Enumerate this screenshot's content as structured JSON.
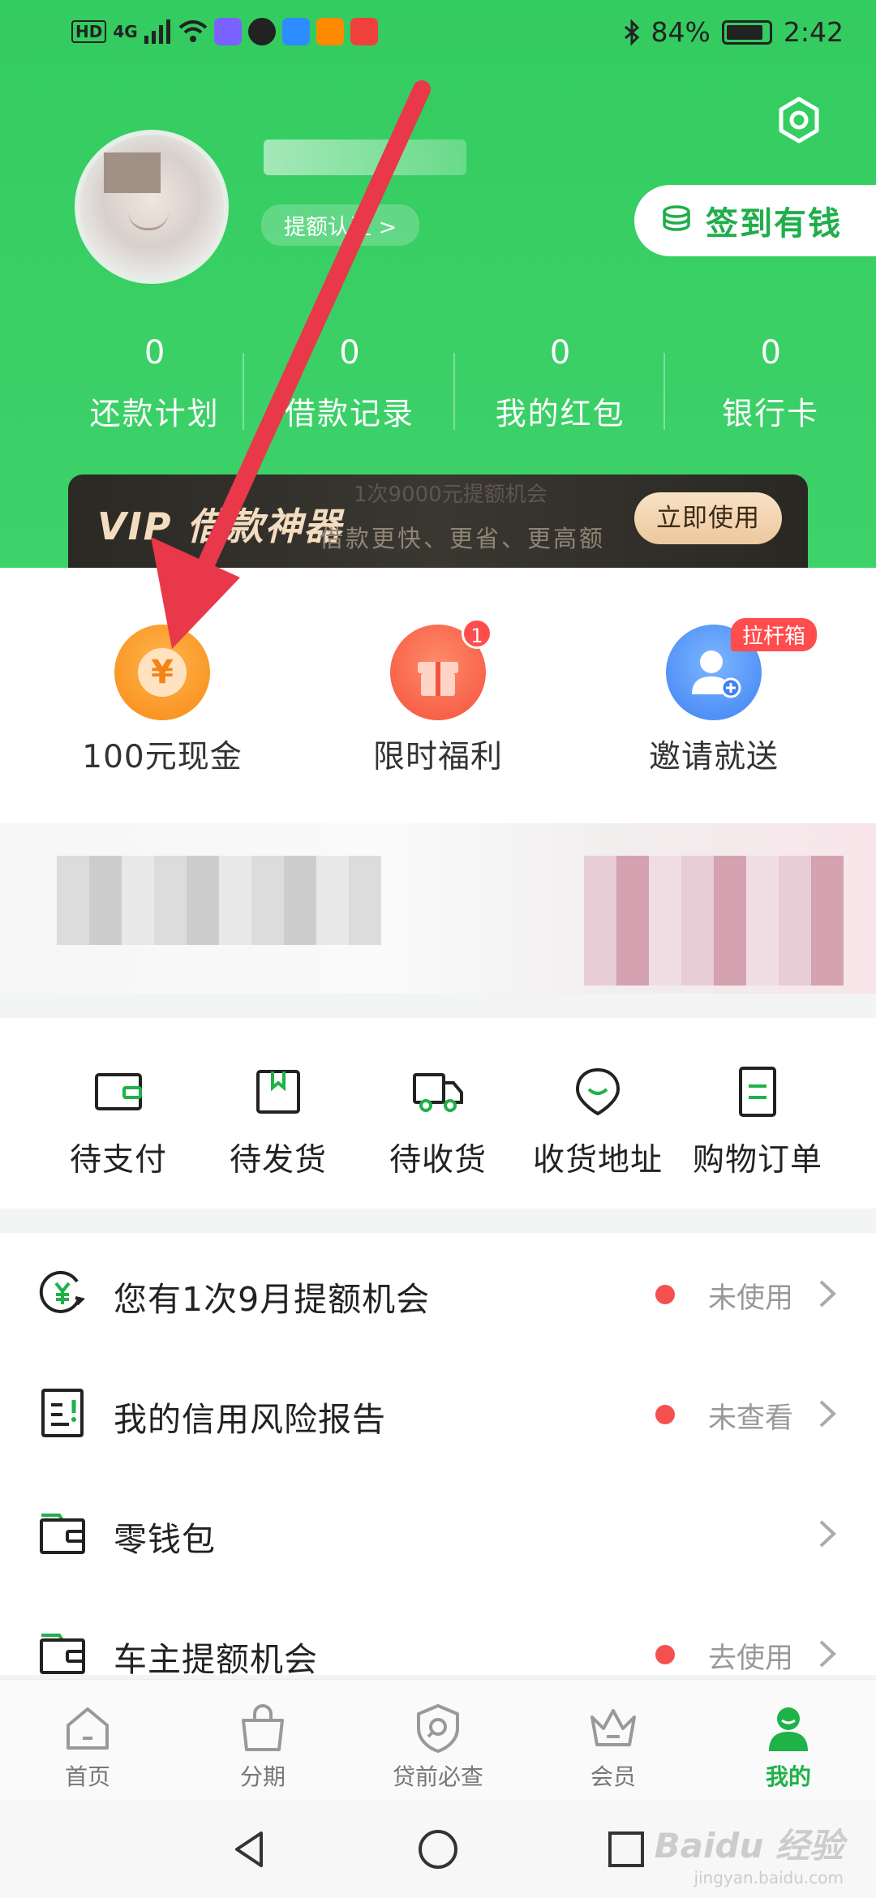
{
  "status_bar": {
    "network": "4G",
    "battery": "84%",
    "time": "2:42"
  },
  "header": {
    "verify_link": "提额认证 >",
    "signin_button": "签到有钱",
    "stats": [
      {
        "value": "0",
        "label": "还款计划"
      },
      {
        "value": "0",
        "label": "借款记录"
      },
      {
        "value": "0",
        "label": "我的红包"
      },
      {
        "value": "0",
        "label": "银行卡"
      }
    ]
  },
  "vip_banner": {
    "title": "VIP 借款神器",
    "subtitle": "借款更快、更省、更高额",
    "faint_text": "1次9000元提额机会",
    "button": "立即使用"
  },
  "quick_actions": [
    {
      "label": "100元现金",
      "icon": "yen-coin-icon"
    },
    {
      "label": "限时福利",
      "icon": "gift-icon",
      "badge": "1"
    },
    {
      "label": "邀请就送",
      "icon": "invite-user-icon",
      "tag": "拉杆箱"
    }
  ],
  "orders": [
    {
      "label": "待支付",
      "icon": "wallet-icon"
    },
    {
      "label": "待发货",
      "icon": "package-icon"
    },
    {
      "label": "待收货",
      "icon": "truck-icon"
    },
    {
      "label": "收货地址",
      "icon": "location-icon"
    },
    {
      "label": "购物订单",
      "icon": "order-doc-icon"
    }
  ],
  "list": [
    {
      "title": "您有1次9月提额机会",
      "status": "未使用",
      "icon": "yen-refresh-icon"
    },
    {
      "title": "我的信用风险报告",
      "status": "未查看",
      "icon": "report-icon"
    },
    {
      "title": "零钱包",
      "status": "",
      "icon": "wallet-icon"
    },
    {
      "title": "车主提额机会",
      "status": "去使用",
      "icon": "wallet-icon"
    }
  ],
  "tabs": [
    {
      "label": "首页",
      "icon": "home-icon"
    },
    {
      "label": "分期",
      "icon": "bag-icon"
    },
    {
      "label": "贷前必查",
      "icon": "shield-search-icon"
    },
    {
      "label": "会员",
      "icon": "crown-icon"
    },
    {
      "label": "我的",
      "icon": "profile-icon",
      "active": true
    }
  ],
  "watermark": {
    "brand": "Baidu 经验",
    "url": "jingyan.baidu.com"
  },
  "colors": {
    "brand_green": "#33cc60",
    "active_tab": "#1eb248",
    "alert_red": "#f55050",
    "annotation_arrow": "#e8384a"
  }
}
